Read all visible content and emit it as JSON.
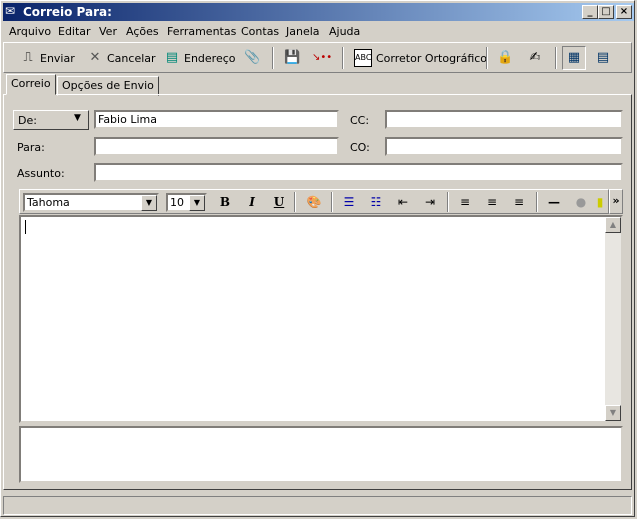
{
  "window": {
    "title": "Correio Para:",
    "minimize": "_",
    "maximize": "□",
    "close": "×"
  },
  "menu": [
    "Arquivo",
    "Editar",
    "Ver",
    "Ações",
    "Ferramentas",
    "Contas",
    "Janela",
    "Ajuda"
  ],
  "toolbar": {
    "send": "Enviar",
    "cancel": "Cancelar",
    "address": "Endereço",
    "spell": "Corretor Ortográfico"
  },
  "tabs": [
    "Correio",
    "Opções de Envio"
  ],
  "form": {
    "from_label": "De:",
    "from_value": "Fabio Lima",
    "to_label": "Para:",
    "to_value": "",
    "subject_label": "Assunto:",
    "subject_value": "",
    "cc_label": "CC:",
    "cc_value": "",
    "bcc_label": "CO:",
    "bcc_value": ""
  },
  "format": {
    "font": "Tahoma",
    "size": "10",
    "bold": "B",
    "italic": "I",
    "underline": "U",
    "more": "»"
  },
  "body": {
    "text": ""
  }
}
